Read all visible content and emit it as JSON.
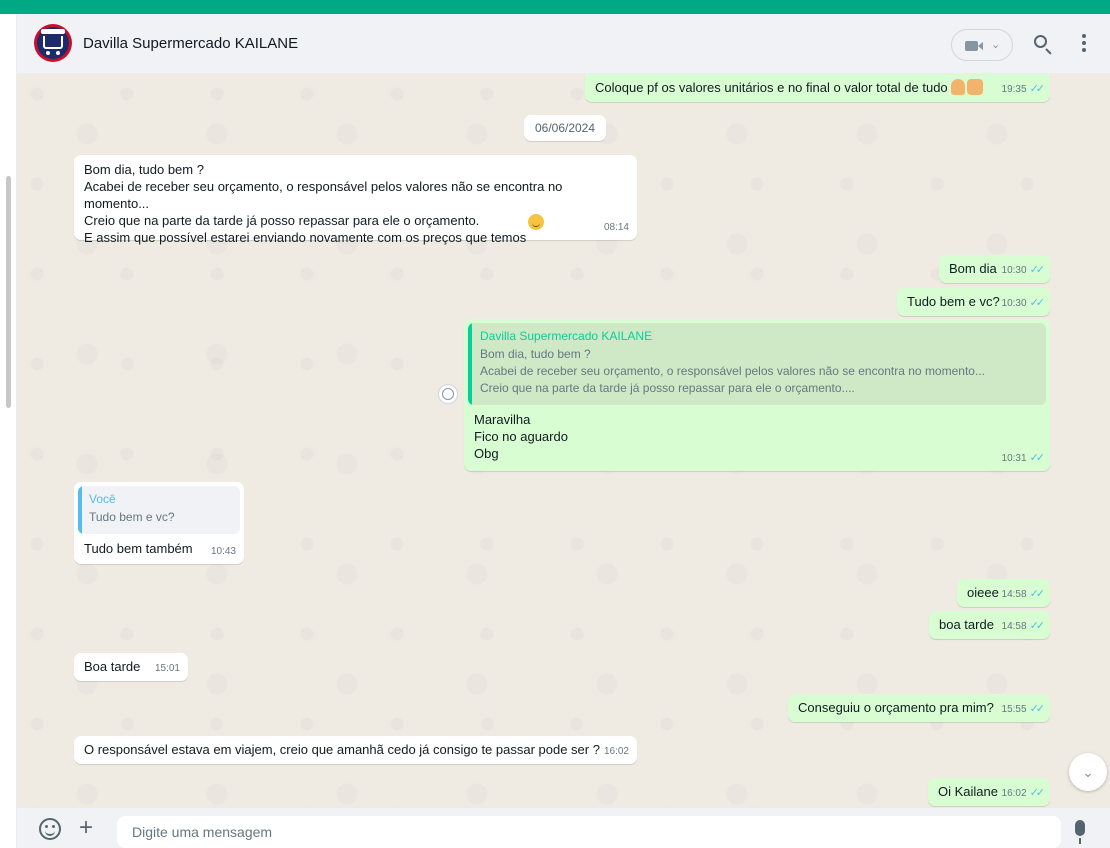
{
  "header": {
    "contact_name": "Davilla Supermercado KAILANE",
    "video_icon": "video-camera-icon",
    "search_icon": "search-icon",
    "menu_icon": "more-vertical-icon"
  },
  "chat": {
    "date_chip": "06/06/2024",
    "messages": [
      {
        "text": "Coloque pf os valores unitários e no final o valor total de tudo",
        "time": "19:35"
      },
      {
        "text": "Bom dia,  tudo bem ?\nAcabei de receber seu orçamento, o responsável pelos valores não se encontra no momento...\nCreio que na parte da tarde já posso repassar para ele o orçamento.\nE assim que possível estarei enviando novamente com os preços que temos",
        "time": "08:14"
      },
      {
        "text": "Bom dia",
        "time": "10:30"
      },
      {
        "text": "Tudo bem e vc?",
        "time": "10:30"
      },
      {
        "text": "Maravilha\nFico no aguardo\nObg",
        "time": "10:31",
        "quote": {
          "author": "Davilla Supermercado KAILANE",
          "text": "Bom dia,  tudo bem ?\nAcabei de receber seu orçamento, o responsável pelos valores não se encontra no momento...\nCreio que na parte da tarde já posso repassar para ele o orçamento...."
        }
      },
      {
        "text": "Tudo bem também",
        "time": "10:43",
        "quote": {
          "author": "Você",
          "text": "Tudo bem e vc?"
        }
      },
      {
        "text": "oieee",
        "time": "14:58"
      },
      {
        "text": "boa tarde",
        "time": "14:58"
      },
      {
        "text": "Boa tarde",
        "time": "15:01"
      },
      {
        "text": "Conseguiu o orçamento pra mim?",
        "time": "15:55"
      },
      {
        "text": "O responsável estava em viajem,  creio que amanhã cedo já consigo te passar pode ser ?",
        "time": "16:02"
      },
      {
        "text": "Oi Kailane",
        "time": "16:02"
      }
    ],
    "read_ticks": "✓✓",
    "colors": {
      "outgoing": "#d9fdd3",
      "incoming": "#ffffff",
      "accent": "#00a884",
      "tick": "#53bdeb"
    }
  },
  "footer": {
    "placeholder": "Digite uma mensagem",
    "emoji_icon": "emoji-icon",
    "plus_icon": "plus-icon",
    "mic_icon": "microphone-icon"
  }
}
